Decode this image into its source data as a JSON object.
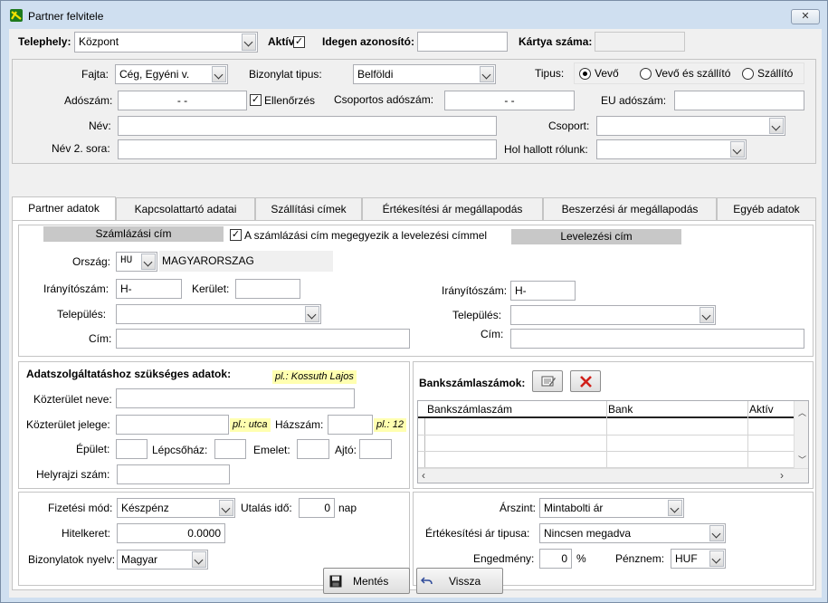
{
  "window": {
    "title": "Partner felvitele",
    "close_glyph": "✕"
  },
  "top": {
    "telephely_label": "Telephely:",
    "telephely_value": "Központ",
    "aktiv_label": "Aktív",
    "aktiv_checked": "✓",
    "idegen_label": "Idegen azonosító:",
    "idegen_value": "",
    "kartya_label": "Kártya száma:",
    "kartya_value": ""
  },
  "partner": {
    "fajta_label": "Fajta:",
    "fajta_value": "Cég, Egyéni v.",
    "bizonylat_label": "Bizonylat tipus:",
    "bizonylat_value": "Belföldi",
    "tipus_label": "Tipus:",
    "tipus_options": [
      "Vevő",
      "Vevő és szállító",
      "Szállító"
    ],
    "adoszam_label": "Adószám:",
    "adoszam_value": "- -",
    "ellenorzes_label": "Ellenőrzés",
    "ellenorzes_checked": "✓",
    "csoportos_label": "Csoportos adószám:",
    "csoportos_value": "- -",
    "eu_label": "EU adószám:",
    "eu_value": "",
    "nev_label": "Név:",
    "nev_value": "",
    "csoport_label": "Csoport:",
    "csoport_value": "",
    "nev2_label": "Név 2. sora:",
    "nev2_value": "",
    "hol_label": "Hol hallott rólunk:",
    "hol_value": ""
  },
  "tabs": [
    "Partner adatok",
    "Kapcsolattartó adatai",
    "Szállítási címek",
    "Értékesítési ár megállapodás",
    "Beszerzési ár megállapodás",
    "Egyéb adatok"
  ],
  "address": {
    "szamlazasi_header": "Számlázási cím",
    "megegyezik_label": "A számlázási cím megegyezik a levelezési címmel",
    "megegyezik_checked": "✓",
    "levelezesi_header": "Levelezési cím",
    "orszag_label": "Ország:",
    "orszag_code": "HU",
    "orszag_name": "MAGYARORSZAG",
    "iranyitoszam_label": "Irányítószám:",
    "iranyitoszam_value": "H-",
    "kerulet_label": "Kerület:",
    "kerulet_value": "",
    "telepules_label": "Település:",
    "telepules_value": "",
    "cim_label": "Cím:",
    "cim_value": "",
    "lev_iranyitoszam_label": "Irányítószám:",
    "lev_iranyitoszam_value": "H-",
    "lev_telepules_label": "Település:",
    "lev_telepules_value": "",
    "lev_cim_label": "Cím:",
    "lev_cim_value": ""
  },
  "service": {
    "title": "Adatszolgáltatáshoz szükséges adatok:",
    "hint_name": "pl.: Kossuth Lajos",
    "kozterulet_neve_label": "Közterület neve:",
    "kozterulet_neve_value": "",
    "kozterulet_jelege_label": "Közterület jelege:",
    "kozterulet_jelege_value": "",
    "hint_jelleg": "pl.: utca",
    "hazszam_label": "Házszám:",
    "hazszam_value": "",
    "hint_hazszam": "pl.: 12",
    "epulet_label": "Épület:",
    "lepcsohaz_label": "Lépcsőház:",
    "emelet_label": "Emelet:",
    "ajto_label": "Ajtó:",
    "helyrajzi_label": "Helyrajzi szám:",
    "helyrajzi_value": ""
  },
  "bank": {
    "title": "Bankszámlaszámok:",
    "columns": [
      "Bankszámlaszám",
      "Bank",
      "Aktív"
    ]
  },
  "payment": {
    "fizetesi_label": "Fizetési mód:",
    "fizetesi_value": "Készpénz",
    "utalas_label": "Utalás idő:",
    "utalas_value": "0",
    "utalas_unit": "nap",
    "hitelkeret_label": "Hitelkeret:",
    "hitelkeret_value": "0.0000",
    "nyelv_label": "Bizonylatok nyelv:",
    "nyelv_value": "Magyar"
  },
  "pricing": {
    "arszint_label": "Árszint:",
    "arszint_value": "Mintabolti ár",
    "ertekesitesi_label": "Értékesítési ár tipusa:",
    "ertekesitesi_value": "Nincsen megadva",
    "engedmeny_label": "Engedmény:",
    "engedmeny_value": "0",
    "engedmeny_unit": "%",
    "penznem_label": "Pénznem:",
    "penznem_value": "HUF"
  },
  "footer": {
    "save_label": "Mentés",
    "back_label": "Vissza"
  },
  "colors": {
    "window_frame": "#cfdff0",
    "client": "#f0f0f0",
    "hint_bg": "#ffffb0",
    "header_band": "#c8c8c8",
    "delete_red": "#d0201a"
  }
}
